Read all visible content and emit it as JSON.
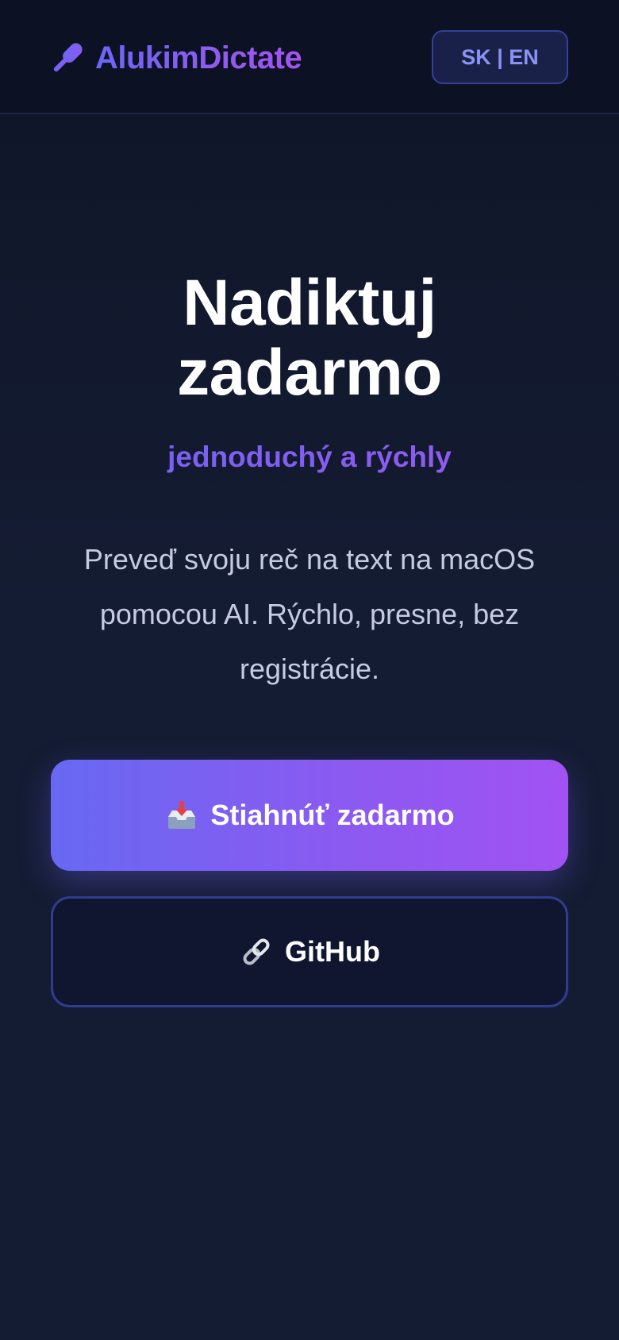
{
  "header": {
    "app_name": "AlukimDictate",
    "logo_icon": "microphone-icon",
    "language_toggle": "SK | EN"
  },
  "hero": {
    "title_line1": "Nadiktuj",
    "title_line2": "zadarmo",
    "subtitle": "jednoduchý a rýchly",
    "description": "Preveď svoju reč na text na macOS pomocou AI. Rýchlo, presne, bez registrácie."
  },
  "actions": {
    "download_label": "Stiahnúť zadarmo",
    "download_icon": "inbox-tray-icon",
    "github_label": "GitHub",
    "github_icon": "link-icon"
  },
  "colors": {
    "background": "#141c33",
    "header_background": "#0c1224",
    "accent_start": "#6869f3",
    "accent_end": "#a152f2",
    "language_toggle_text": "#8a93f5"
  }
}
